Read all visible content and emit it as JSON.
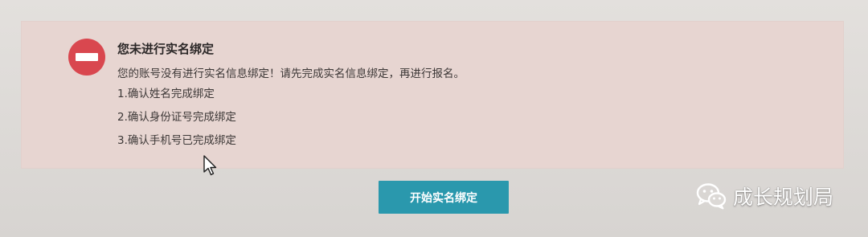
{
  "alert": {
    "icon": "stop-icon",
    "icon_color": "#d9474f",
    "background": "#e7d5d1",
    "title": "您未进行实名绑定",
    "message": "您的账号没有进行实名信息绑定！请先完成实名信息绑定，再进行报名。",
    "steps": [
      "1.确认姓名完成绑定",
      "2.确认身份证号完成绑定",
      "3.确认手机号已完成绑定"
    ]
  },
  "actions": {
    "start_binding_label": "开始实名绑定",
    "button_color": "#2a98ad"
  },
  "watermark": {
    "icon": "wechat-icon",
    "text": "成长规划局"
  }
}
